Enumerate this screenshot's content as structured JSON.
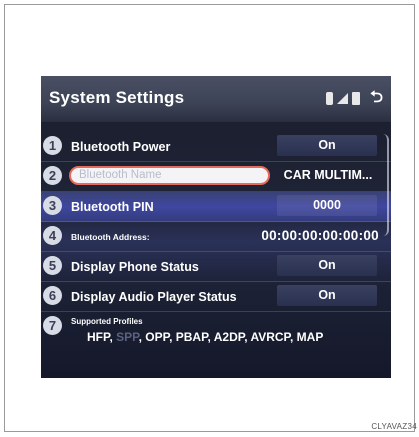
{
  "header": {
    "title": "System Settings"
  },
  "status_icons": [
    "bluetooth-icon",
    "signal-icon",
    "battery-icon",
    "back-icon"
  ],
  "rows": [
    {
      "num": "1",
      "label": "Bluetooth Power",
      "value": "On"
    },
    {
      "num": "2",
      "label": "Bluetooth Name",
      "value": "CAR MULTIM..."
    },
    {
      "num": "3",
      "label": "Bluetooth PIN",
      "value": "0000"
    },
    {
      "num": "4",
      "label": "Bluetooth Address:",
      "value": "00:00:00:00:00:00"
    },
    {
      "num": "5",
      "label": "Display Phone Status",
      "value": "On"
    },
    {
      "num": "6",
      "label": "Display Audio Player Status",
      "value": "On"
    },
    {
      "num": "7",
      "label": "Supported Profiles",
      "profiles_hfp": "HFP,",
      "profiles_spp": "SPP",
      "profiles_rest": ", OPP, PBAP, A2DP, AVRCP, MAP"
    }
  ],
  "caption": "CLYAVAZ34"
}
